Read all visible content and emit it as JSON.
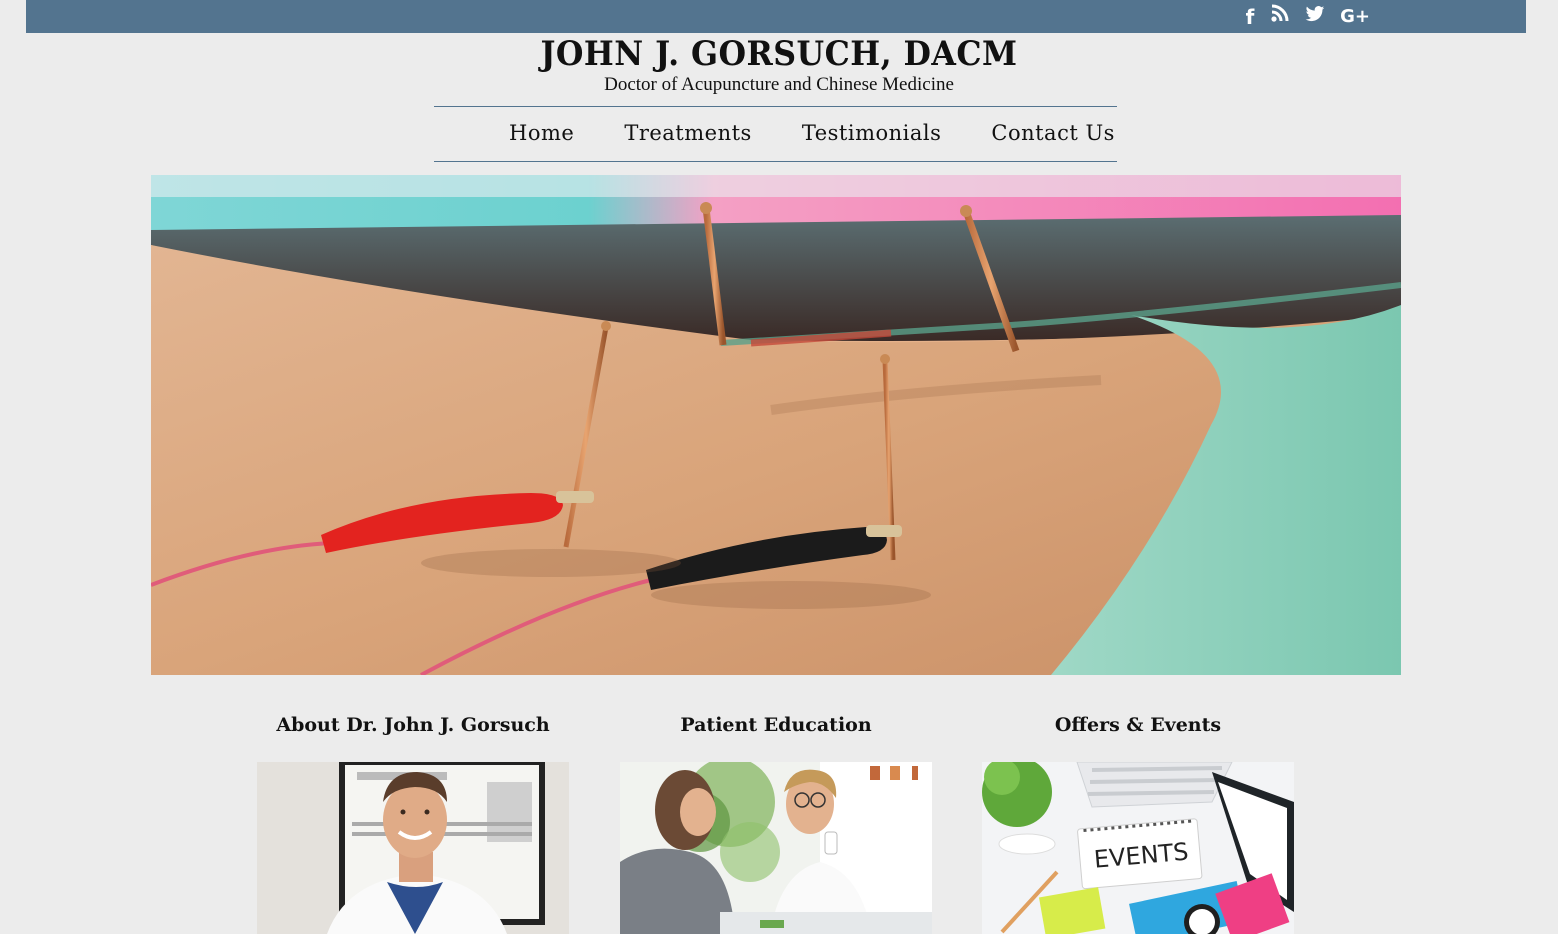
{
  "header": {
    "social": [
      {
        "icon": "facebook-icon",
        "glyph": "f"
      },
      {
        "icon": "rss-icon",
        "glyph": "◞"
      },
      {
        "icon": "twitter-icon",
        "glyph": "❦"
      },
      {
        "icon": "google-plus-icon",
        "glyph": "G+"
      }
    ],
    "title": "JOHN J. GORSUCH, DACM",
    "subtitle": "Doctor of Acupuncture and Chinese Medicine"
  },
  "nav": {
    "items": [
      {
        "label": "Home"
      },
      {
        "label": "Treatments"
      },
      {
        "label": "Testimonials"
      },
      {
        "label": "Contact Us"
      }
    ]
  },
  "colors": {
    "topbar": "#53748f",
    "background": "#ececec",
    "text": "#111111"
  },
  "sections": [
    {
      "title": "About Dr. John J. Gorsuch",
      "image": "doctor-portrait"
    },
    {
      "title": "Patient Education",
      "image": "patient-consultation"
    },
    {
      "title": "Offers & Events",
      "image": "events-desk"
    }
  ],
  "events_sign": "EVENTS"
}
